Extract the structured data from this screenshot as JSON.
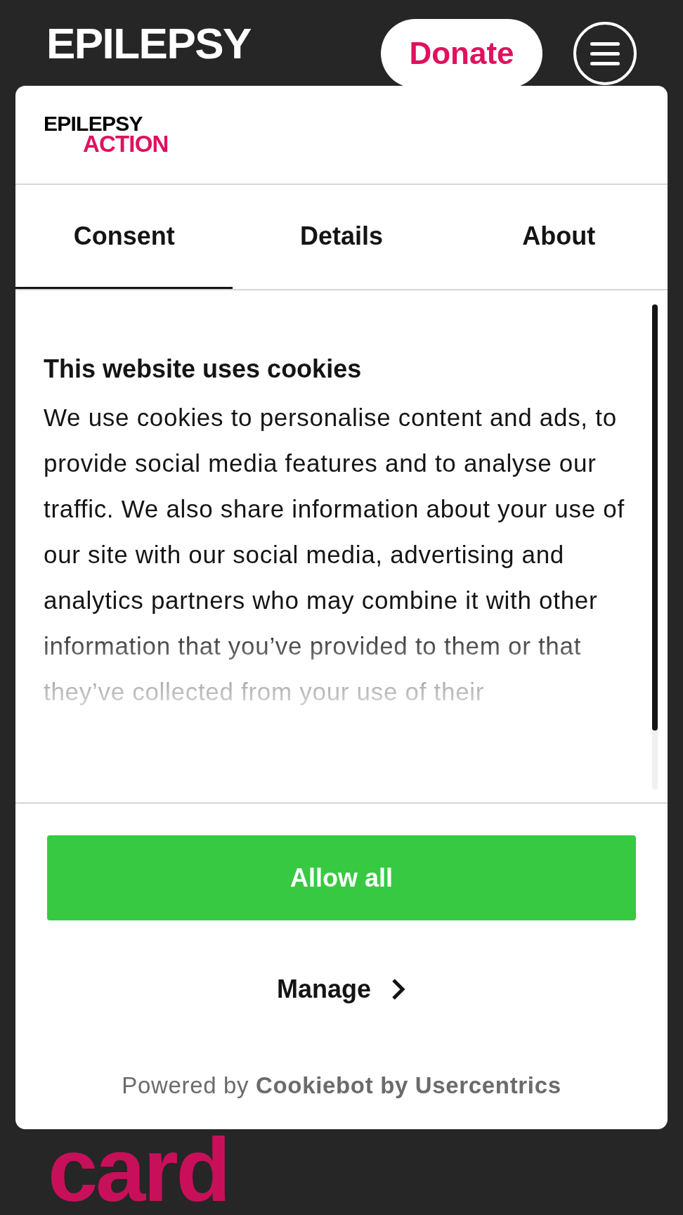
{
  "site_header": {
    "logo": {
      "line_1": "EPILEPSY"
    },
    "donate_button": "Donate"
  },
  "cookie_dialog": {
    "logo": {
      "line_1": "EPILEPSY",
      "line_2": "ACTION"
    },
    "tabs": [
      {
        "label": "Consent",
        "selected": true
      },
      {
        "label": "Details",
        "selected": false
      },
      {
        "label": "About",
        "selected": false
      }
    ],
    "heading": "This website uses cookies",
    "body": "We use cookies to personalise content and ads, to provide social media features and to analyse our traffic. We also share information about your use of our site with our social media, advertising and analytics partners who may combine it with other information that you’ve provided to them or that they’ve collected from your use of their",
    "allow_button": "Allow all",
    "manage_button": "Manage",
    "powered_by": "Powered by **Cookiebot by Usercentrics**"
  },
  "page_heading": "card"
}
